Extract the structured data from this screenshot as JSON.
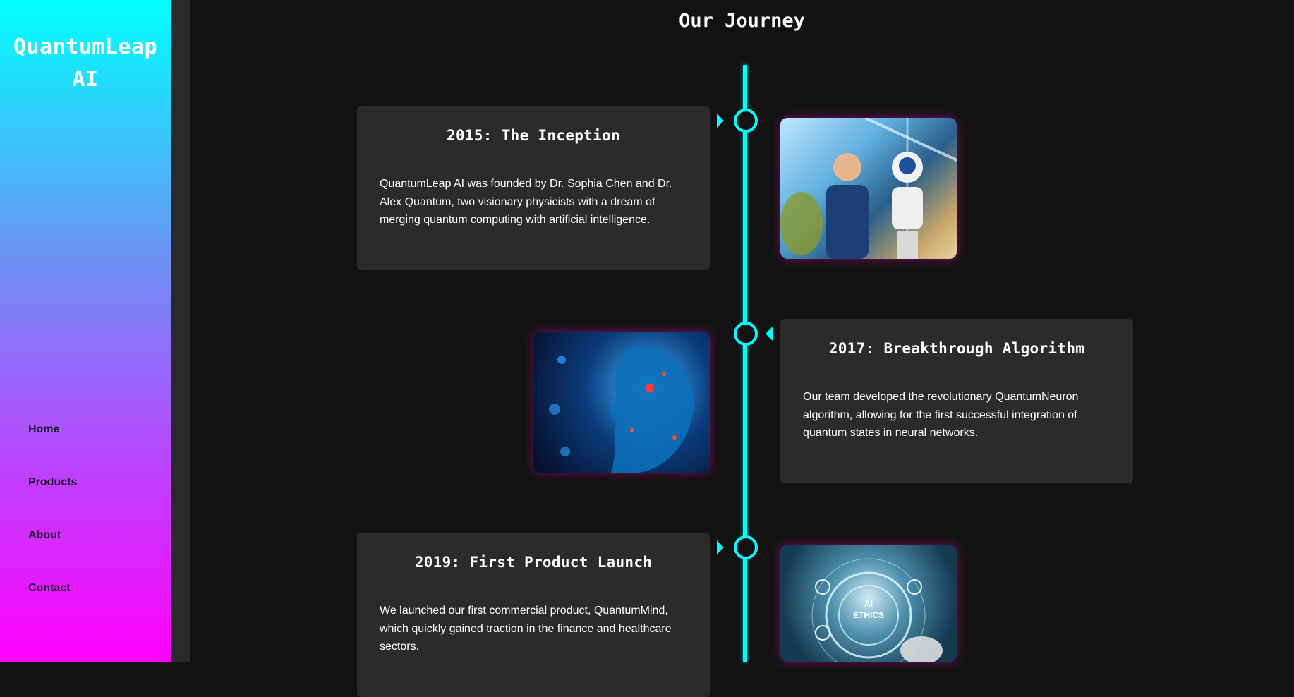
{
  "brand": {
    "line1": "QuantumLeap",
    "line2": "AI"
  },
  "nav": [
    {
      "label": "Home"
    },
    {
      "label": "Products"
    },
    {
      "label": "About"
    },
    {
      "label": "Contact"
    }
  ],
  "page_title": "Our Journey",
  "timeline": [
    {
      "title": "2015: The Inception",
      "text": "QuantumLeap AI was founded by Dr. Sophia Chen and Dr. Alex Quantum, two visionary physicists with a dream of merging quantum computing with artificial intelligence.",
      "image": "businessman-and-robot-image"
    },
    {
      "title": "2017: Breakthrough Algorithm",
      "text": "Our team developed the revolutionary QuantumNeuron algorithm, allowing for the first successful integration of quantum states in neural networks.",
      "image": "digital-face-image"
    },
    {
      "title": "2019: First Product Launch",
      "text": "We launched our first commercial product, QuantumMind, which quickly gained traction in the finance and healthcare sectors.",
      "image": "ai-ethics-image",
      "image_text": "AI ETHICS"
    }
  ],
  "colors": {
    "accent": "#00ffff",
    "magenta": "#ff00ff",
    "background": "#121212",
    "card": "#2b2b2b"
  }
}
